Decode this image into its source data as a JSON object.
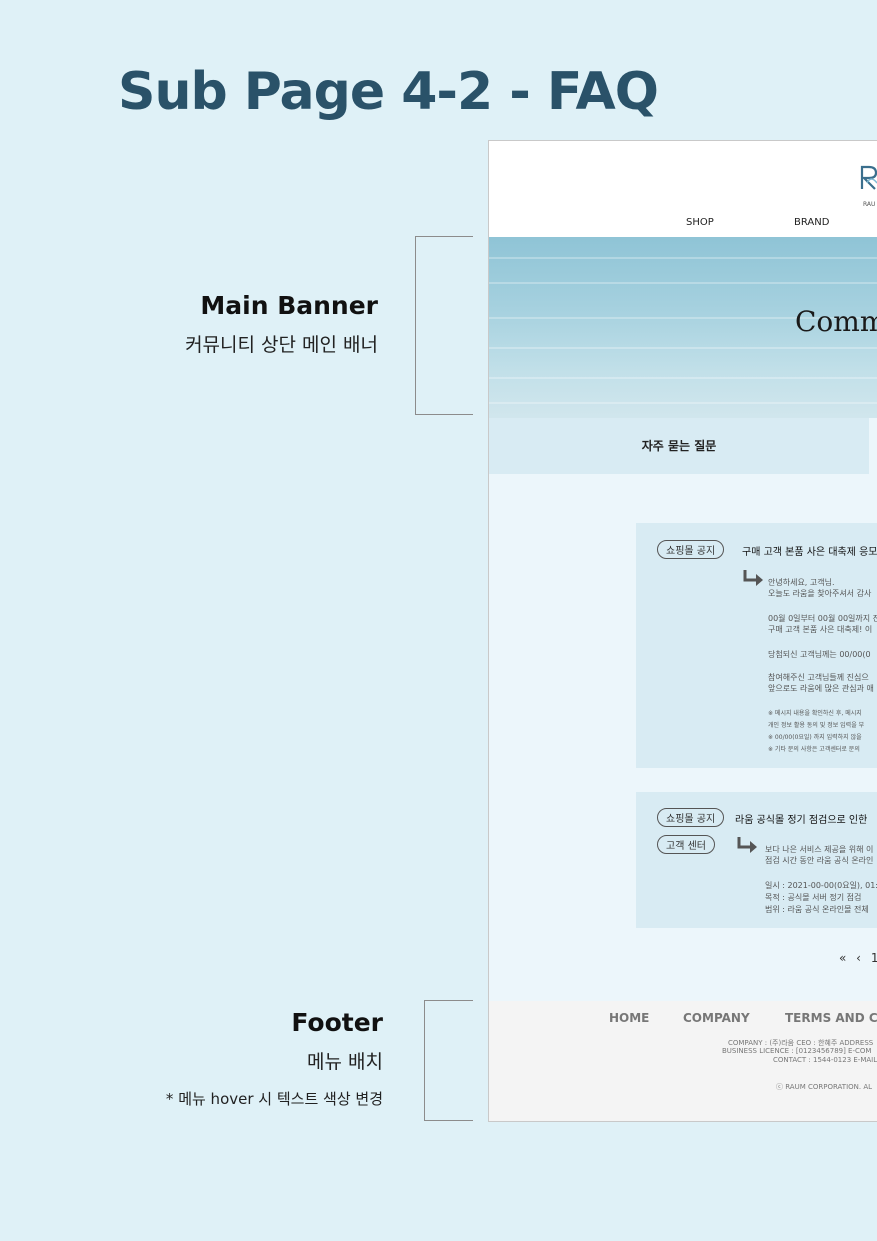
{
  "page": {
    "title": "Sub Page 4-2 - FAQ"
  },
  "annotations": {
    "banner": {
      "title": "Main Banner",
      "subtitle": "커뮤니티 상단 메인 배너"
    },
    "footer": {
      "title": "Footer",
      "subtitle": "메뉴 배치",
      "note": "* 메뉴 hover 시 텍스트 색상 변경"
    }
  },
  "mockup": {
    "logo_text": "RAU",
    "nav": [
      "SHOP",
      "BRAND"
    ],
    "banner_title": "Comm",
    "tab_label": "자주 묻는 질문",
    "faq": [
      {
        "badges": [
          "쇼핑몰 공지"
        ],
        "title": "구매 고객 본품 사은 대축제 응모",
        "greeting": "안녕하세요, 고객님.",
        "lines": [
          "오늘도 라움을 찾아주셔서 감사",
          "00월 0일부터 00월 00일까지 진",
          "구매 고객 본품 사은 대축제! 이",
          "당첨되신 고객님께는 00/00(0",
          "참여해주신 고객님들께 진심으",
          "앞으로도 라움에 많은 관심과 애"
        ],
        "notes": [
          "※ 메시지 내용을 확인하신 후, 메시지",
          "개인 정보 활용 동의 및 정보 입력을 부",
          "※ 00/00(0요일) 까지 입력하지 않을",
          "※ 기타 문의 사항은 고객센터로 문의"
        ]
      },
      {
        "badges": [
          "쇼핑몰 공지",
          "고객 센터"
        ],
        "title": "라움 공식몰 정기 점검으로 인한",
        "lines": [
          "보다 나은 서비스 제공을 위해 이",
          "점검 시간 동안 라움 공식 온라인",
          "일시 : 2021-00-00(0요일), 01:",
          "목적 : 공식몰 서버 정기 점검",
          "범위 : 라움 공식 온라인몰 전체"
        ]
      }
    ],
    "pager": {
      "first": "«",
      "prev": "‹",
      "page": "1"
    },
    "footer": {
      "menu": [
        "HOME",
        "COMPANY",
        "TERMS AND CON"
      ],
      "info": [
        "COMPANY : (주)라움 CEO : 한혜주 ADDRESS",
        "BUSINESS LICENCE : [0123456789]  E-COM",
        "CONTACT : 1544-0123 E-MAIL"
      ],
      "copyright": "ⓒ RAUM CORPORATION. AL"
    }
  }
}
